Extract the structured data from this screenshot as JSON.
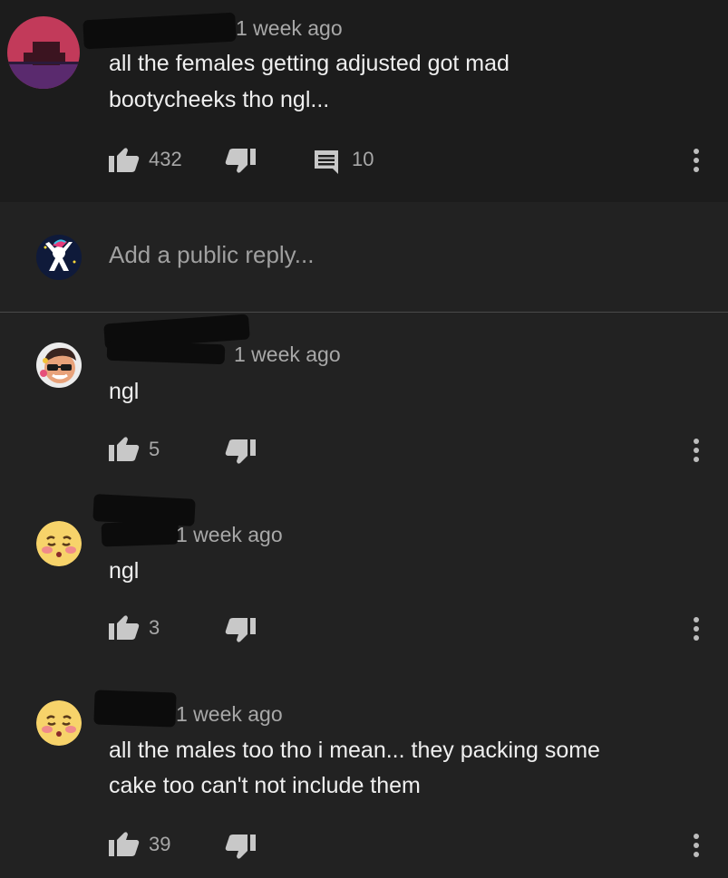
{
  "parent_comment": {
    "time": "1 week ago",
    "text_line1": "all the females getting adjusted got mad",
    "text_line2": "bootycheeks tho ngl...",
    "likes": "432",
    "replies": "10"
  },
  "reply_box": {
    "placeholder": "Add a public reply..."
  },
  "replies": [
    {
      "time": "1 week ago",
      "text": "ngl",
      "likes": "5"
    },
    {
      "time": "1 week ago",
      "text": "ngl",
      "likes": "3"
    },
    {
      "time": "1 week ago",
      "text_line1": "all the males too tho i mean... they packing some",
      "text_line2": "cake too can't not include them",
      "likes": "39"
    }
  ],
  "icons": {
    "like": "thumbs-up-icon",
    "dislike": "thumbs-down-icon",
    "reply": "comment-icon",
    "more": "more-vert-icon"
  },
  "colors": {
    "background": "#222222",
    "top_band": "#1c1c1c",
    "text": "#efefef",
    "secondary": "#a8a8a8"
  }
}
